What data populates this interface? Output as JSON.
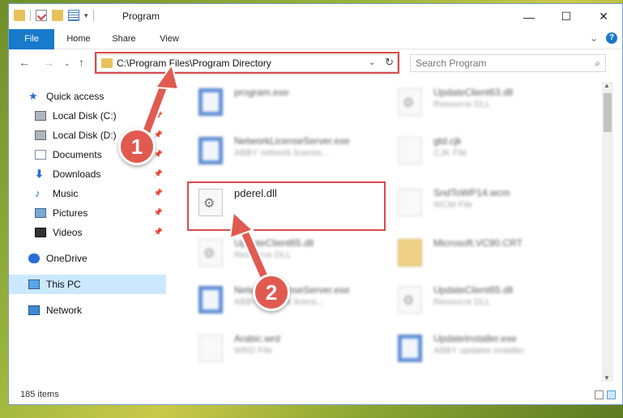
{
  "window": {
    "title": "Program",
    "minimize": "—",
    "maximize": "☐",
    "close": "✕"
  },
  "ribbon": {
    "tabs": [
      "File",
      "Home",
      "Share",
      "View"
    ],
    "help": "?"
  },
  "nav": {
    "back": "←",
    "forward": "→",
    "up": "↑"
  },
  "address": {
    "path": "C:\\Program Files\\Program Directory",
    "refresh": "↻",
    "dropdown": "⌄"
  },
  "search": {
    "placeholder": "Search Program",
    "icon": "⌕"
  },
  "sidebar": {
    "items": [
      {
        "label": "Quick access",
        "icon": "star-icon"
      },
      {
        "label": "Local Disk (C:)",
        "icon": "disk-icon"
      },
      {
        "label": "Local Disk (D:)",
        "icon": "disk-icon"
      },
      {
        "label": "Documents",
        "icon": "documents-icon"
      },
      {
        "label": "Downloads",
        "icon": "downloads-icon"
      },
      {
        "label": "Music",
        "icon": "music-icon"
      },
      {
        "label": "Pictures",
        "icon": "pictures-icon"
      },
      {
        "label": "Videos",
        "icon": "videos-icon"
      },
      {
        "label": "OneDrive",
        "icon": "cloud-icon"
      },
      {
        "label": "This PC",
        "icon": "computer-icon"
      },
      {
        "label": "Network",
        "icon": "network-icon"
      }
    ]
  },
  "files": [
    {
      "name": "program.exe",
      "type": ""
    },
    {
      "name": "UpdateClient63.dll",
      "type": "Resource DLL"
    },
    {
      "name": "NetworkLicenseServer.exe",
      "type": "ABBY network license..."
    },
    {
      "name": "gtd.cjk",
      "type": "CJK File"
    },
    {
      "name": "pderel.dll",
      "type": ""
    },
    {
      "name": "SndToWP14.wcm",
      "type": "WCM File"
    },
    {
      "name": "UpdateClient65.dll",
      "type": "Resource DLL"
    },
    {
      "name": "Microsoft.VC90.CRT",
      "type": ""
    },
    {
      "name": "NetworkLicenseServer.exe",
      "type": "ABBY network licens..."
    },
    {
      "name": "UpdateClient65.dll",
      "type": "Resource DLL"
    },
    {
      "name": "Arabic.wrd",
      "type": "WRD File"
    },
    {
      "name": "UpdateInstaller.exe",
      "type": "ABBY updates installer"
    }
  ],
  "status": {
    "count": "185 items"
  },
  "callouts": {
    "one": "1",
    "two": "2"
  },
  "colors": {
    "highlight": "#d94a4a",
    "callout": "#e05a50",
    "accent": "#1979ca"
  }
}
